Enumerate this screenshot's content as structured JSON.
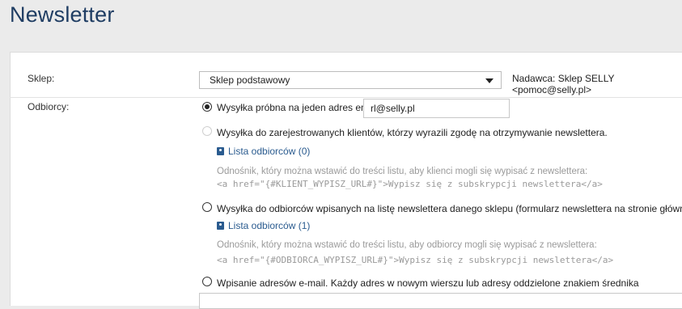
{
  "page": {
    "title": "Newsletter"
  },
  "form": {
    "shop": {
      "label": "Sklep:",
      "selected": "Sklep podstawowy",
      "sender": "Nadawca: Sklep SELLY <pomoc@selly.pl>"
    },
    "recipients": {
      "label": "Odbiorcy:",
      "options": [
        {
          "text": "Wysyłka próbna na jeden adres email:",
          "checked": true,
          "disabled": false,
          "input_value": "rl@selly.pl"
        },
        {
          "text": "Wysyłka do zarejestrowanych klientów, którzy wyrazili zgodę na otrzymywanie newslettera.",
          "checked": false,
          "disabled": true,
          "link": "Lista odbiorców (0)",
          "hint": "Odnośnik, który można wstawić do treści listu, aby klienci mogli się wypisać z newslettera:",
          "code": "<a href=\"{#KLIENT_WYPISZ_URL#}\">Wypisz się z subskrypcji newslettera</a>"
        },
        {
          "text": "Wysyłka do odbiorców wpisanych na listę newslettera danego sklepu (formularz newslettera na stronie głównej).",
          "checked": false,
          "disabled": false,
          "link": "Lista odbiorców (1)",
          "hint": "Odnośnik, który można wstawić do treści listu, aby odbiorcy mogli się wypisać z newslettera:",
          "code": "<a href=\"{#ODBIORCA_WYPISZ_URL#}\">Wypisz się z subskrypcji newslettera</a>"
        },
        {
          "text": "Wpisanie adresów e-mail. Każdy adres w nowym wierszu lub adresy oddzielone znakiem średnika",
          "checked": false,
          "disabled": false
        }
      ]
    }
  },
  "icons": {
    "select_caret": "caret-down-icon",
    "list": "address-book-icon"
  }
}
